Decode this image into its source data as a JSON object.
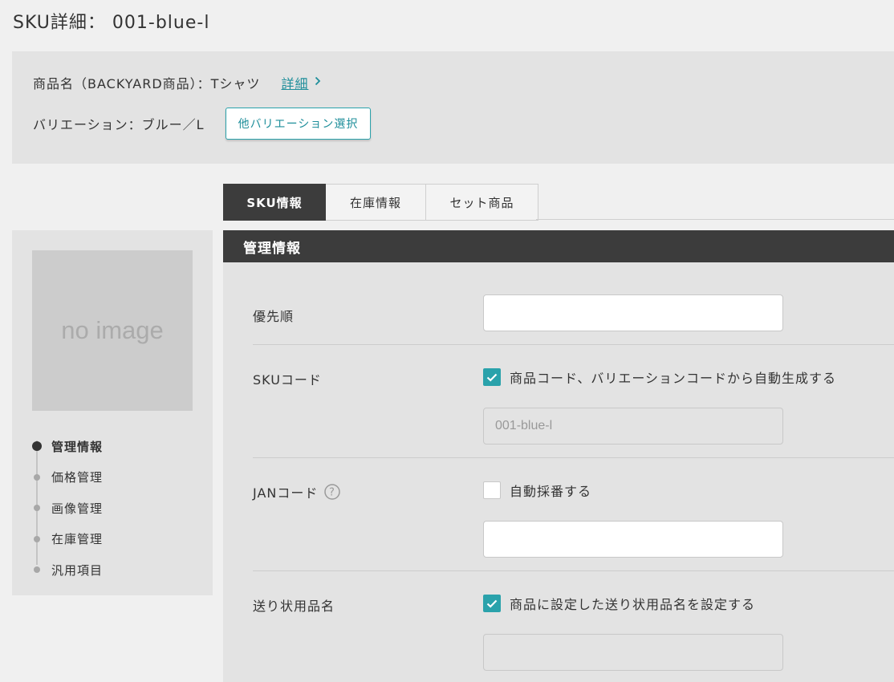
{
  "page": {
    "title": "SKU詳細： 001-blue-l"
  },
  "info": {
    "product_name": "商品名（BACKYARD商品）：Tシャツ",
    "detail_link": "詳細",
    "variation": "バリエーション：ブルー／L",
    "other_variation_button": "他バリエーション選択"
  },
  "sidebar": {
    "no_image": "no image",
    "nav": [
      {
        "label": "管理情報",
        "active": true
      },
      {
        "label": "価格管理",
        "active": false
      },
      {
        "label": "画像管理",
        "active": false
      },
      {
        "label": "在庫管理",
        "active": false
      },
      {
        "label": "汎用項目",
        "active": false
      }
    ]
  },
  "tabs": [
    {
      "label": "SKU情報",
      "active": true
    },
    {
      "label": "在庫情報",
      "active": false
    },
    {
      "label": "セット商品",
      "active": false
    }
  ],
  "section": {
    "title": "管理情報"
  },
  "form": {
    "priority": {
      "label": "優先順",
      "value": ""
    },
    "sku_code": {
      "label": "SKUコード",
      "auto_checkbox": "商品コード、バリエーションコードから自動生成する",
      "auto_checked": true,
      "value": "001-blue-l"
    },
    "jan_code": {
      "label": "JANコード",
      "auto_checkbox": "自動採番する",
      "auto_checked": false,
      "value": ""
    },
    "shipping_name": {
      "label": "送り状用品名",
      "auto_checkbox": "商品に設定した送り状用品名を設定する",
      "auto_checked": true,
      "value": ""
    }
  },
  "colors": {
    "accent": "#2aa2ab",
    "dark": "#3c3c3c",
    "panel": "#e3e3e3"
  }
}
